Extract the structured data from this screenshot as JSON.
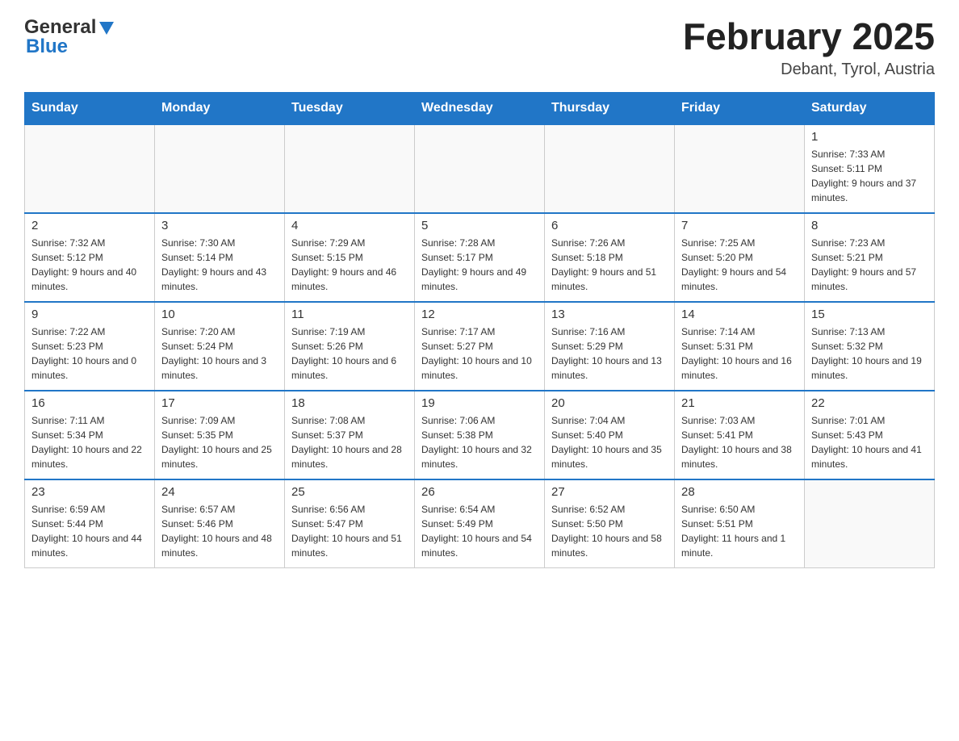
{
  "header": {
    "logo": {
      "general": "General",
      "blue": "Blue"
    },
    "title": "February 2025",
    "location": "Debant, Tyrol, Austria"
  },
  "calendar": {
    "days_of_week": [
      "Sunday",
      "Monday",
      "Tuesday",
      "Wednesday",
      "Thursday",
      "Friday",
      "Saturday"
    ],
    "weeks": [
      [
        {
          "day": "",
          "info": ""
        },
        {
          "day": "",
          "info": ""
        },
        {
          "day": "",
          "info": ""
        },
        {
          "day": "",
          "info": ""
        },
        {
          "day": "",
          "info": ""
        },
        {
          "day": "",
          "info": ""
        },
        {
          "day": "1",
          "info": "Sunrise: 7:33 AM\nSunset: 5:11 PM\nDaylight: 9 hours and 37 minutes."
        }
      ],
      [
        {
          "day": "2",
          "info": "Sunrise: 7:32 AM\nSunset: 5:12 PM\nDaylight: 9 hours and 40 minutes."
        },
        {
          "day": "3",
          "info": "Sunrise: 7:30 AM\nSunset: 5:14 PM\nDaylight: 9 hours and 43 minutes."
        },
        {
          "day": "4",
          "info": "Sunrise: 7:29 AM\nSunset: 5:15 PM\nDaylight: 9 hours and 46 minutes."
        },
        {
          "day": "5",
          "info": "Sunrise: 7:28 AM\nSunset: 5:17 PM\nDaylight: 9 hours and 49 minutes."
        },
        {
          "day": "6",
          "info": "Sunrise: 7:26 AM\nSunset: 5:18 PM\nDaylight: 9 hours and 51 minutes."
        },
        {
          "day": "7",
          "info": "Sunrise: 7:25 AM\nSunset: 5:20 PM\nDaylight: 9 hours and 54 minutes."
        },
        {
          "day": "8",
          "info": "Sunrise: 7:23 AM\nSunset: 5:21 PM\nDaylight: 9 hours and 57 minutes."
        }
      ],
      [
        {
          "day": "9",
          "info": "Sunrise: 7:22 AM\nSunset: 5:23 PM\nDaylight: 10 hours and 0 minutes."
        },
        {
          "day": "10",
          "info": "Sunrise: 7:20 AM\nSunset: 5:24 PM\nDaylight: 10 hours and 3 minutes."
        },
        {
          "day": "11",
          "info": "Sunrise: 7:19 AM\nSunset: 5:26 PM\nDaylight: 10 hours and 6 minutes."
        },
        {
          "day": "12",
          "info": "Sunrise: 7:17 AM\nSunset: 5:27 PM\nDaylight: 10 hours and 10 minutes."
        },
        {
          "day": "13",
          "info": "Sunrise: 7:16 AM\nSunset: 5:29 PM\nDaylight: 10 hours and 13 minutes."
        },
        {
          "day": "14",
          "info": "Sunrise: 7:14 AM\nSunset: 5:31 PM\nDaylight: 10 hours and 16 minutes."
        },
        {
          "day": "15",
          "info": "Sunrise: 7:13 AM\nSunset: 5:32 PM\nDaylight: 10 hours and 19 minutes."
        }
      ],
      [
        {
          "day": "16",
          "info": "Sunrise: 7:11 AM\nSunset: 5:34 PM\nDaylight: 10 hours and 22 minutes."
        },
        {
          "day": "17",
          "info": "Sunrise: 7:09 AM\nSunset: 5:35 PM\nDaylight: 10 hours and 25 minutes."
        },
        {
          "day": "18",
          "info": "Sunrise: 7:08 AM\nSunset: 5:37 PM\nDaylight: 10 hours and 28 minutes."
        },
        {
          "day": "19",
          "info": "Sunrise: 7:06 AM\nSunset: 5:38 PM\nDaylight: 10 hours and 32 minutes."
        },
        {
          "day": "20",
          "info": "Sunrise: 7:04 AM\nSunset: 5:40 PM\nDaylight: 10 hours and 35 minutes."
        },
        {
          "day": "21",
          "info": "Sunrise: 7:03 AM\nSunset: 5:41 PM\nDaylight: 10 hours and 38 minutes."
        },
        {
          "day": "22",
          "info": "Sunrise: 7:01 AM\nSunset: 5:43 PM\nDaylight: 10 hours and 41 minutes."
        }
      ],
      [
        {
          "day": "23",
          "info": "Sunrise: 6:59 AM\nSunset: 5:44 PM\nDaylight: 10 hours and 44 minutes."
        },
        {
          "day": "24",
          "info": "Sunrise: 6:57 AM\nSunset: 5:46 PM\nDaylight: 10 hours and 48 minutes."
        },
        {
          "day": "25",
          "info": "Sunrise: 6:56 AM\nSunset: 5:47 PM\nDaylight: 10 hours and 51 minutes."
        },
        {
          "day": "26",
          "info": "Sunrise: 6:54 AM\nSunset: 5:49 PM\nDaylight: 10 hours and 54 minutes."
        },
        {
          "day": "27",
          "info": "Sunrise: 6:52 AM\nSunset: 5:50 PM\nDaylight: 10 hours and 58 minutes."
        },
        {
          "day": "28",
          "info": "Sunrise: 6:50 AM\nSunset: 5:51 PM\nDaylight: 11 hours and 1 minute."
        },
        {
          "day": "",
          "info": ""
        }
      ]
    ]
  }
}
